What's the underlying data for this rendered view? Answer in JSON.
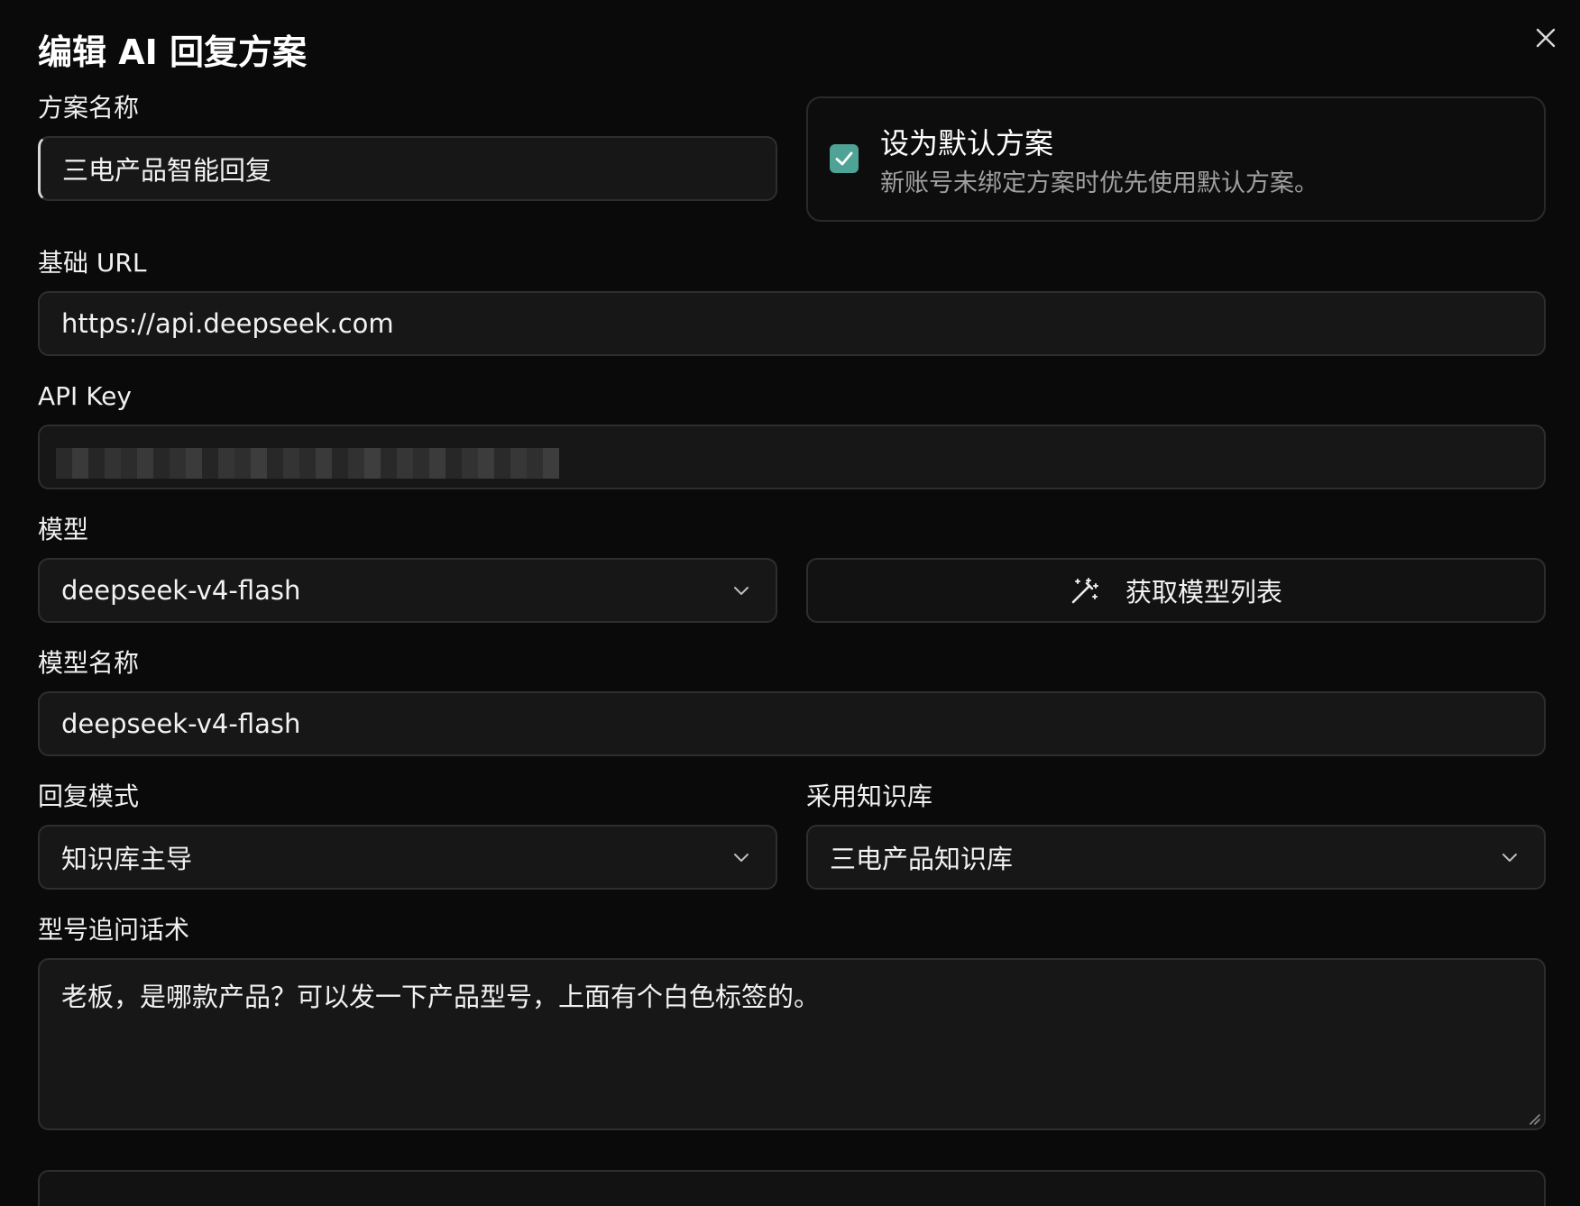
{
  "dialog": {
    "title": "编辑 AI 回复方案",
    "close_icon": "close-icon"
  },
  "form": {
    "plan_name": {
      "label": "方案名称",
      "value": "三电产品智能回复"
    },
    "default_plan": {
      "checked": true,
      "title": "设为默认方案",
      "description": "新账号未绑定方案时优先使用默认方案。"
    },
    "base_url": {
      "label": "基础 URL",
      "value": "https://api.deepseek.com"
    },
    "api_key": {
      "label": "API Key"
    },
    "model": {
      "label": "模型",
      "selected": "deepseek-v4-flash",
      "fetch_button_label": "获取模型列表",
      "fetch_icon": "magic-wand-icon"
    },
    "model_name": {
      "label": "模型名称",
      "value": "deepseek-v4-flash"
    },
    "reply_mode": {
      "label": "回复模式",
      "selected": "知识库主导"
    },
    "knowledge_base": {
      "label": "采用知识库",
      "selected": "三电产品知识库"
    },
    "model_inquiry_script": {
      "label": "型号追问话术",
      "value": "老板，是哪款产品？可以发一下产品型号，上面有个白色标签的。"
    }
  },
  "colors": {
    "background": "#0a0a0a",
    "field_background": "#171717",
    "border": "#2e2e2e",
    "accent_checkbox": "#4fa396",
    "muted_text": "#a0a0a0"
  }
}
